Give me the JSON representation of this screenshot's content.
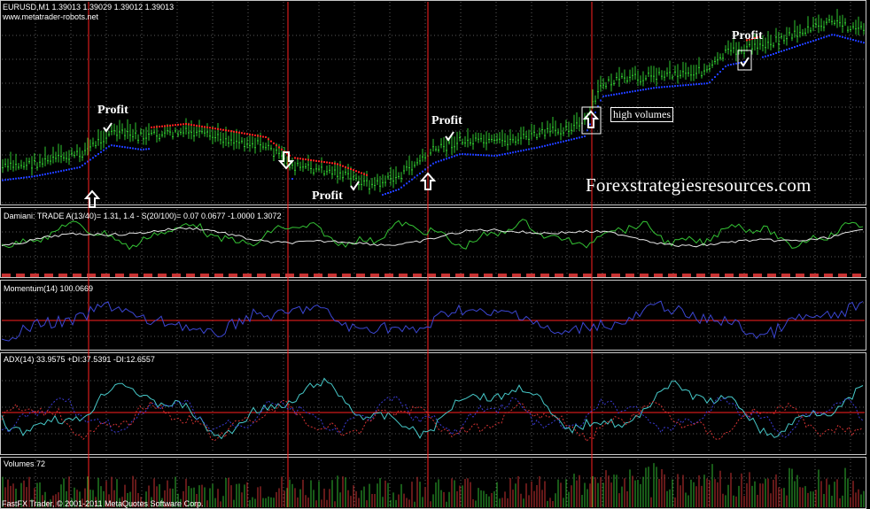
{
  "header": {
    "symbol_quote": "EURUSD,M1  1.39013 1.39029 1.39012 1.39013",
    "site": "www.metatrader-robots.net"
  },
  "annotations": {
    "profit_1": "Profit",
    "profit_2": "Profit",
    "profit_3": "Profit",
    "profit_4": "Profit",
    "high_volumes": "high volumes",
    "watermark": "Forexstrategiesresources.com"
  },
  "indicators": {
    "damiani": "Damiani: TRADE  A(13/40)= 1.31, 1.4 - S(20/100)= 0.07  0.0677 -1.0000 1.3072",
    "momentum": "Momentum(14) 100.0669",
    "adx": "ADX(14) 33.9575 +DI:37.5391 -DI:12.6557",
    "volumes": "Volumes 72"
  },
  "footer": "FastFX Trader, © 2001-2011 MetaQuotes Software Corp.",
  "colors": {
    "candles": "#2fc82f",
    "trend_up": "#1e3cff",
    "trend_down": "#ff2020",
    "separator": "#ff2020",
    "grid": "#5a5a5a",
    "damiani_fast": "#34c234",
    "damiani_slow": "#e6e6e6",
    "momentum": "#3c46d2",
    "adx": "#46c8c8",
    "plus_di": "#3a3ad2",
    "minus_di": "#d23232",
    "volume": "#c83232"
  }
}
